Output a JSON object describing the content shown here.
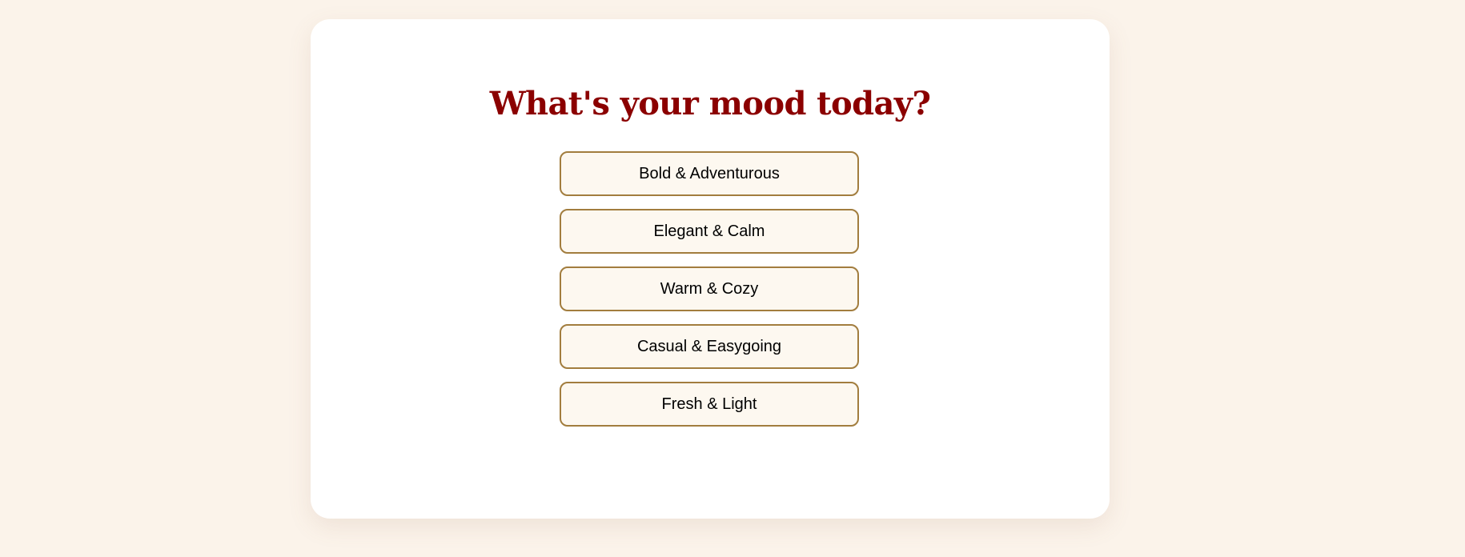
{
  "question": {
    "title": "What's your mood today?"
  },
  "options": [
    {
      "label": "Bold & Adventurous"
    },
    {
      "label": "Elegant & Calm"
    },
    {
      "label": "Warm & Cozy"
    },
    {
      "label": "Casual & Easygoing"
    },
    {
      "label": "Fresh & Light"
    }
  ],
  "colors": {
    "background": "#fbf3ea",
    "card": "#ffffff",
    "title": "#8b0000",
    "option_border": "#a27d3e",
    "option_fill": "#fdf8f0"
  }
}
